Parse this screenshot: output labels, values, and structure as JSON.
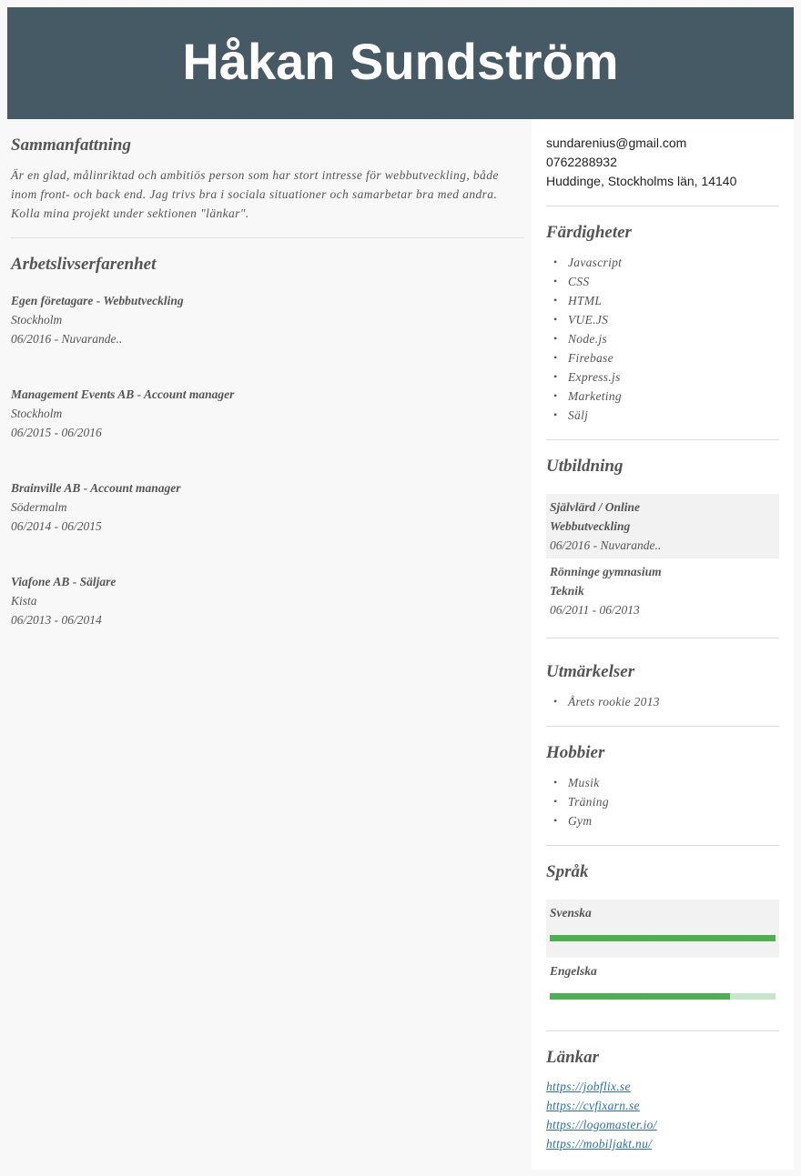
{
  "header": {
    "name": "Håkan Sundström"
  },
  "summary": {
    "title": "Sammanfattning",
    "text": "Är en glad, målinriktad och ambitiös person som har stort intresse för webbutveckling, både inom front- och back end. Jag trivs bra i sociala situationer och samarbetar bra med andra. Kolla mina projekt under sektionen \"länkar\"."
  },
  "work": {
    "title": "Arbetslivserfarenhet",
    "jobs": [
      {
        "title": "Egen företagare - Webbutveckling",
        "location": "Stockholm",
        "period": "06/2016 - Nuvarande.."
      },
      {
        "title": "Management Events AB - Account manager",
        "location": "Stockholm",
        "period": "06/2015 - 06/2016"
      },
      {
        "title": "Brainville AB - Account manager",
        "location": "Södermalm",
        "period": "06/2014 - 06/2015"
      },
      {
        "title": "Viafone AB - Säljare",
        "location": "Kista",
        "period": "06/2013 - 06/2014"
      }
    ]
  },
  "contact": {
    "email": "sundarenius@gmail.com",
    "phone": "0762288932",
    "address": "Huddinge, Stockholms län, 14140"
  },
  "skills": {
    "title": "Färdigheter",
    "items": [
      "Javascript",
      "CSS",
      "HTML",
      "VUE.JS",
      "Node.js",
      "Firebase",
      "Express.js",
      "Marketing",
      "Sälj"
    ]
  },
  "education": {
    "title": "Utbildning",
    "items": [
      {
        "school": "Självlärd / Online",
        "program": "Webbutveckling",
        "period": "06/2016 - Nuvarande.."
      },
      {
        "school": "Rönninge gymnasium",
        "program": "Teknik",
        "period": "06/2011 - 06/2013"
      }
    ]
  },
  "awards": {
    "title": "Utmärkelser",
    "items": [
      "Årets rookie 2013"
    ]
  },
  "hobbies": {
    "title": "Hobbier",
    "items": [
      "Musik",
      "Träning",
      "Gym"
    ]
  },
  "languages": {
    "title": "Språk",
    "items": [
      {
        "name": "Svenska",
        "level": 1.0
      },
      {
        "name": "Engelska",
        "level": 0.8
      }
    ],
    "bar_color": "#4caf50",
    "bar_track_color": "#c8e6c9"
  },
  "links": {
    "title": "Länkar",
    "items": [
      "https://jobflix.se",
      "https://cvfixarn.se",
      "https://logomaster.io/",
      "https://mobiljakt.nu/"
    ]
  },
  "colors": {
    "header_bg": "#465a66",
    "link": "#2a6fb5"
  }
}
